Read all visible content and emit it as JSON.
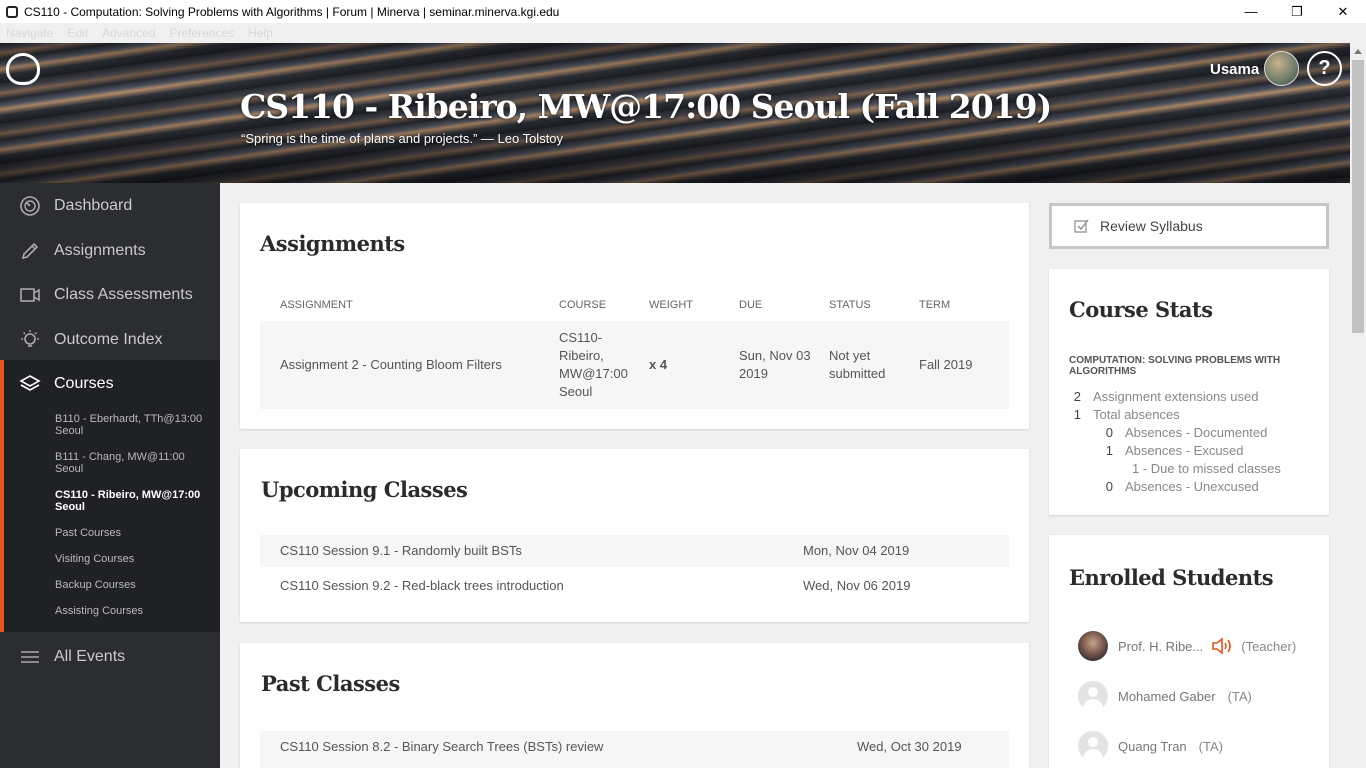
{
  "window": {
    "title": "CS110 - Computation: Solving Problems with Algorithms | Forum | Minerva | seminar.minerva.kgi.edu",
    "menu": [
      "Navigate",
      "Edit",
      "Advanced",
      "Preferences",
      "Help"
    ]
  },
  "header": {
    "course_title": "CS110 - Ribeiro, MW@17:00 Seoul (Fall 2019)",
    "quote": "“Spring is the time of plans and projects.” — Leo Tolstoy",
    "user_name": "Usama",
    "help_label": "?"
  },
  "sidebar": {
    "items": [
      {
        "label": "Dashboard",
        "icon": "dashboard-icon"
      },
      {
        "label": "Assignments",
        "icon": "pencil-icon"
      },
      {
        "label": "Class Assessments",
        "icon": "video-icon"
      },
      {
        "label": "Outcome Index",
        "icon": "lightbulb-icon"
      }
    ],
    "courses": {
      "label": "Courses",
      "sub_items": [
        "B110 - Eberhardt, TTh@13:00 Seoul",
        "B111 - Chang, MW@11:00 Seoul",
        "CS110 - Ribeiro, MW@17:00 Seoul",
        "Past Courses",
        "Visiting Courses",
        "Backup Courses",
        "Assisting Courses"
      ],
      "active_index": 2
    },
    "all_events": "All Events"
  },
  "assignments": {
    "title": "Assignments",
    "headers": [
      "ASSIGNMENT",
      "COURSE",
      "WEIGHT",
      "DUE",
      "STATUS",
      "TERM"
    ],
    "rows": [
      {
        "assignment": "Assignment 2 - Counting Bloom Filters",
        "course_lines": [
          "CS110-",
          "Ribeiro,",
          "MW@17:00",
          "Seoul"
        ],
        "weight": "x 4",
        "due_lines": [
          "Sun, Nov 03",
          "2019"
        ],
        "status_lines": [
          "Not yet",
          "submitted"
        ],
        "term": "Fall 2019"
      }
    ]
  },
  "upcoming": {
    "title": "Upcoming Classes",
    "rows": [
      {
        "name": "CS110 Session 9.1 - Randomly built BSTs",
        "date": "Mon, Nov 04 2019"
      },
      {
        "name": "CS110 Session 9.2 - Red-black trees introduction",
        "date": "Wed, Nov 06 2019"
      }
    ]
  },
  "past": {
    "title": "Past Classes",
    "rows": [
      {
        "name": "CS110 Session 8.2 - Binary Search Trees (BSTs) review",
        "date": "Wed, Oct 30 2019"
      }
    ]
  },
  "review_syllabus": "Review Syllabus",
  "course_stats": {
    "title": "Course Stats",
    "subtitle": "COMPUTATION: SOLVING PROBLEMS WITH ALGORITHMS",
    "stats": [
      {
        "num": "2",
        "label": "Assignment extensions used"
      },
      {
        "num": "1",
        "label": "Total absences"
      },
      {
        "num": "0",
        "label": "Absences - Documented"
      },
      {
        "num": "1",
        "label": "Absences - Excused"
      },
      {
        "num": "",
        "label": "1 - Due to missed classes"
      },
      {
        "num": "0",
        "label": "Absences - Unexcused"
      }
    ]
  },
  "enrolled": {
    "title": "Enrolled Students",
    "students": [
      {
        "name": "Prof. H. Ribe...",
        "role": "(Teacher)",
        "has_photo": true,
        "speaker_icon": "speaker-icon"
      },
      {
        "name": "Mohamed Gaber",
        "role": "(TA)",
        "has_photo": false
      },
      {
        "name": "Quang Tran",
        "role": "(TA)",
        "has_photo": false
      }
    ]
  },
  "colors": {
    "accent": "#e4531b",
    "sidebar_bg": "#2c2d31",
    "sidebar_active_bg": "#202125"
  }
}
